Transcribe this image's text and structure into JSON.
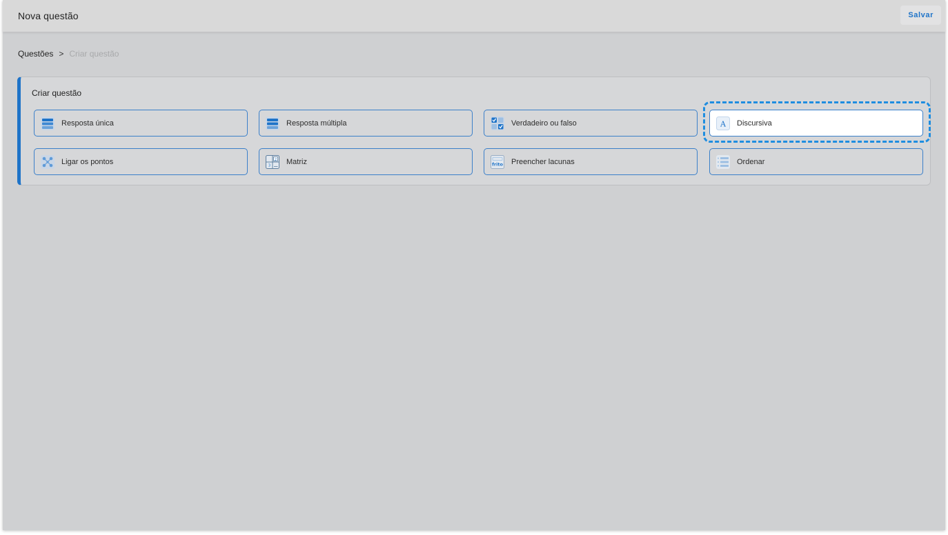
{
  "header": {
    "title": "Nova questão",
    "save_label": "Salvar"
  },
  "breadcrumb": {
    "root": "Questões",
    "separator": ">",
    "current": "Criar questão"
  },
  "card": {
    "title": "Criar questão",
    "options": [
      {
        "label": "Resposta única",
        "icon": "single-answer-icon"
      },
      {
        "label": "Resposta múltipla",
        "icon": "multiple-answer-icon"
      },
      {
        "label": "Verdadeiro ou falso",
        "icon": "true-false-icon"
      },
      {
        "label": "Discursiva",
        "icon": "text-answer-icon",
        "selected": true
      },
      {
        "label": "Ligar os pontos",
        "icon": "connect-dots-icon"
      },
      {
        "label": "Matriz",
        "icon": "matrix-icon"
      },
      {
        "label": "Preencher lacunas",
        "icon": "fill-blanks-icon",
        "icon_text": "frito"
      },
      {
        "label": "Ordenar",
        "icon": "ordering-icon"
      }
    ]
  },
  "colors": {
    "accent": "#1e73c8",
    "focus": "#1e8de0",
    "background": "#cfd0d2"
  }
}
